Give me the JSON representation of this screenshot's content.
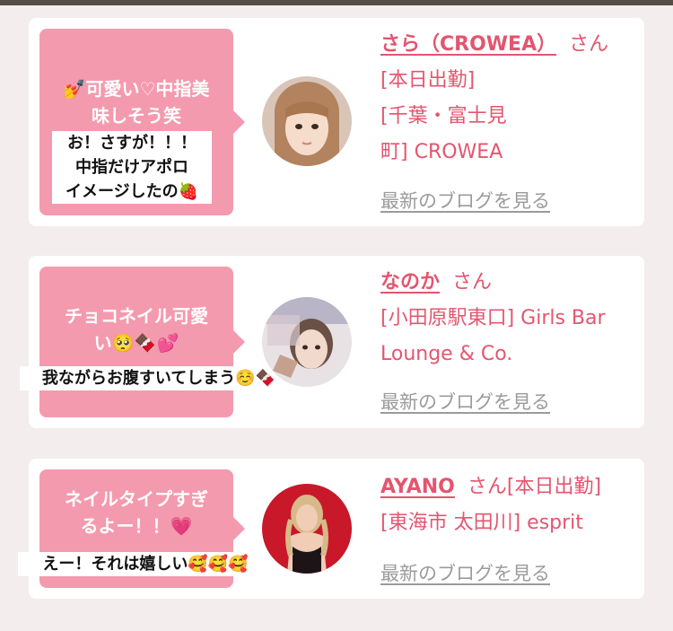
{
  "colors": {
    "accent": "#e4556f",
    "bubble": "#f49aae",
    "link_gray": "#9b9b9b",
    "topbar": "#574b45"
  },
  "entries": [
    {
      "bubble_lines": [
        "💅可愛い♡中指美",
        "味しそう笑"
      ],
      "sticker_lines": [
        "お！さすが！！！",
        "中指だけアポロ",
        "イメージしたの🍓"
      ],
      "name": "さら（CROWEA）",
      "san": "さん",
      "info_line1": "[本日出勤]",
      "info_line2": "[千葉・富士見",
      "info_line3": "町] CROWEA",
      "blog_link": "最新のブログを見る"
    },
    {
      "bubble_lines": [
        "チョコネイル可愛",
        "い🥺🍫💕"
      ],
      "sticker_lines": [
        "我ながらお腹すいてしまう☺️🍫"
      ],
      "name": "なのか",
      "san": "さん",
      "info_line1": "[小田原駅東口] Girls Bar",
      "info_line2": "Lounge & Co.",
      "blog_link": "最新のブログを見る"
    },
    {
      "bubble_lines": [
        "ネイルタイプすぎ",
        "るよー！！💗"
      ],
      "sticker_lines": [
        "えー！それは嬉しい🥰🥰🥰"
      ],
      "name": "AYANO",
      "san": "さん[本日出勤]",
      "info_line1": "[東海市 太田川] esprit",
      "blog_link": "最新のブログを見る"
    }
  ]
}
